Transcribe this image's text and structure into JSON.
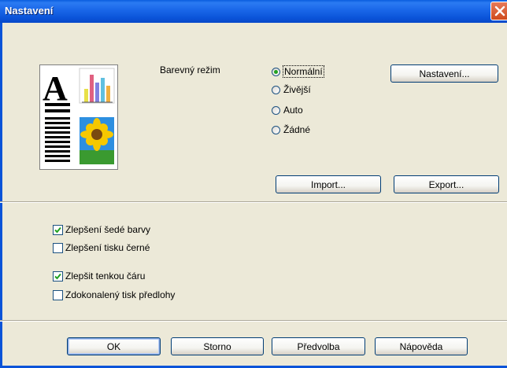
{
  "window": {
    "title": "Nastavení"
  },
  "color_mode": {
    "label": "Barevný režim",
    "options": [
      "Normální",
      "Živější",
      "Auto",
      "Žádné"
    ],
    "selected": "Normální"
  },
  "buttons": {
    "settings": "Nastavení...",
    "import": "Import...",
    "export": "Export...",
    "ok": "OK",
    "cancel": "Storno",
    "preset": "Předvolba",
    "help": "Nápověda"
  },
  "checkboxes": [
    {
      "label": "Zlepšení šedé barvy",
      "checked": true
    },
    {
      "label": "Zlepšení tisku černé",
      "checked": false
    },
    {
      "label": "Zlepšit tenkou čáru",
      "checked": true
    },
    {
      "label": "Zdokonalený tisk předlohy",
      "checked": false
    }
  ],
  "preview": {
    "letter": "A"
  },
  "colors": {
    "titlebar": "#0A53D8",
    "dialog_bg": "#ECE9D8",
    "radio_dot": "#21A121",
    "check_mark": "#21A121"
  }
}
